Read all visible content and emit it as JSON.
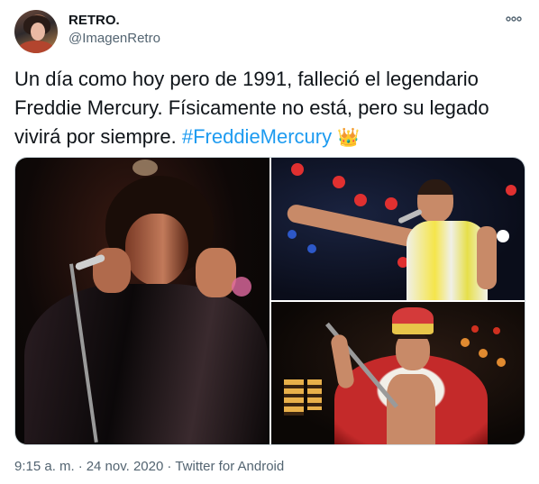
{
  "tweet": {
    "display_name": "RETRO.",
    "handle": "@ImagenRetro",
    "more_icon": "more-horizontal-icon",
    "text": "Un día como hoy pero de 1991, falleció el legendario Freddie Mercury. Físicamente no está, pero su legado vivirá por siempre. ",
    "hashtag": "#FreddieMercury",
    "emoji": "👑",
    "time": "9:15 a. m.",
    "separator": "·",
    "date": "24 nov. 2020",
    "source": "Twitter for Android"
  },
  "colors": {
    "text_primary": "#0f1419",
    "text_secondary": "#536471",
    "link": "#1d9bf0",
    "border": "#cfd9de"
  }
}
